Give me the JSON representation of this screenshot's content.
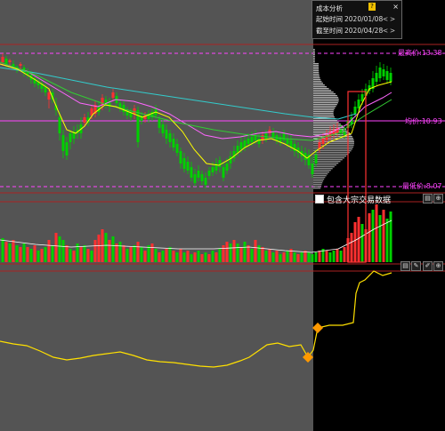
{
  "colors": {
    "up": "#ff3030",
    "down": "#00d000",
    "ma_yellow": "#ffff00",
    "ma_pink": "#ff66ff",
    "ma_green": "#33cc33",
    "ma_cyan": "#33cccc",
    "ref_line": "#ff44ff",
    "cost_line": "#ffe000",
    "highlight_box": "#ff3333"
  },
  "price_panel": {
    "high_label": "最高价:13.38",
    "avg_label": "均价:10.93",
    "low_label": "最低价:8.07",
    "price_levels": {
      "high": 13.38,
      "avg": 10.93,
      "low": 8.07
    }
  },
  "include_block_trade": "包含大宗交易数据",
  "cost_dialog": {
    "title": "成本分析",
    "help": "?",
    "close": "×",
    "start_label": "起始时间",
    "start_value": "2020/01/08",
    "end_label": "截至时间",
    "end_value": "2020/04/28",
    "prev": "<",
    "next": ">"
  },
  "icons": [
    "menu-icon",
    "edit-icon",
    "zoom-icon"
  ]
}
